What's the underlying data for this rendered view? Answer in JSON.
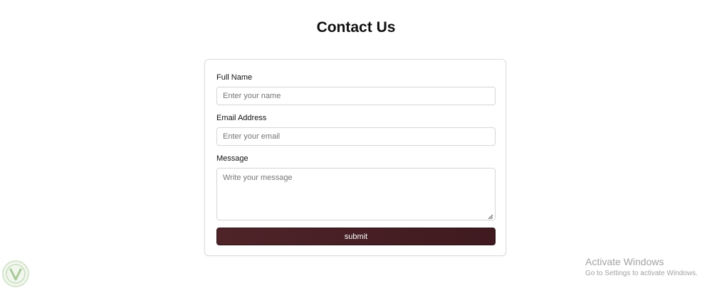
{
  "page": {
    "title": "Contact Us"
  },
  "form": {
    "full_name": {
      "label": "Full Name",
      "placeholder": "Enter your name"
    },
    "email": {
      "label": "Email Address",
      "placeholder": "Enter your email"
    },
    "message": {
      "label": "Message",
      "placeholder": "Write your message"
    },
    "submit_label": "submit"
  },
  "os_overlay": {
    "activate_title": "Activate Windows",
    "activate_hint": "Go to Settings to activate Windows.",
    "watermark_icon": "leaf-logo-icon"
  },
  "colors": {
    "button_bg": "#4a2227",
    "text": "#111111",
    "border": "#dcdcdc"
  }
}
